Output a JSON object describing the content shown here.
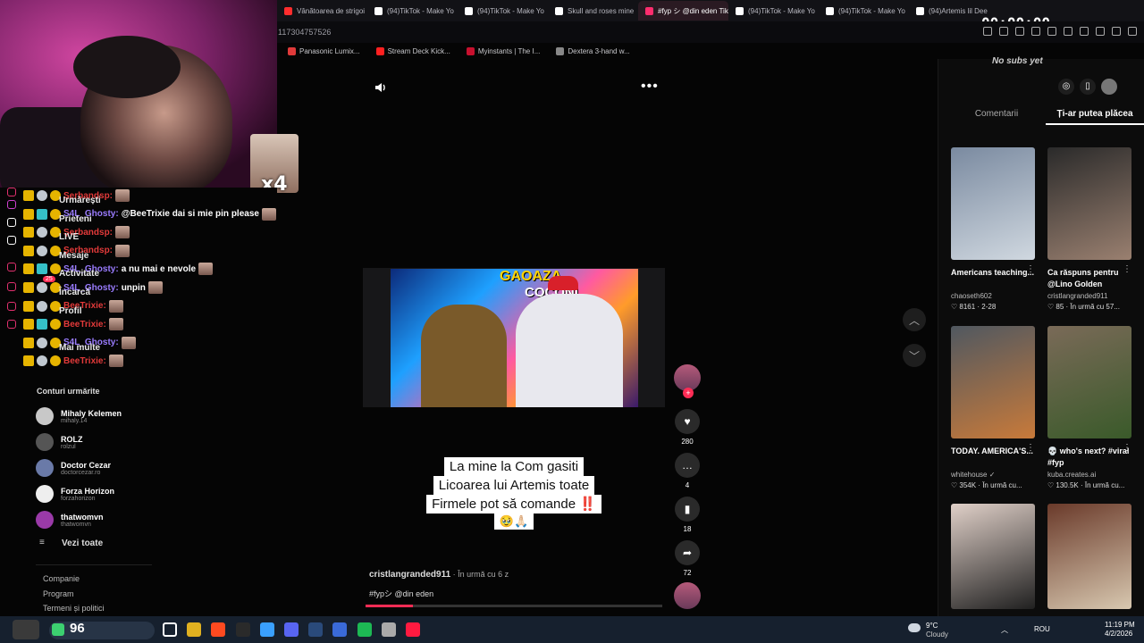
{
  "browser": {
    "tabs": [
      {
        "label": "Vânătoarea de strigoi",
        "color": "#ff2d2d"
      },
      {
        "label": "(94)TikTok - Make Yo",
        "color": "#ffffff"
      },
      {
        "label": "(94)TikTok - Make Yo",
        "color": "#ffffff"
      },
      {
        "label": "Skull and roses mine",
        "color": "#ffffff"
      },
      {
        "label": "#fyp シ @din eden TikTok",
        "color": "#ff2d6e",
        "active": true
      },
      {
        "label": "(94)TikTok - Make Yo",
        "color": "#ffffff"
      },
      {
        "label": "(94)TikTok - Make Yo",
        "color": "#ffffff"
      },
      {
        "label": "(94)Artemis lil Dee",
        "color": "#ffffff"
      }
    ],
    "address_fragment": "117304757526",
    "timer": "00:00:00",
    "bookmarks": [
      {
        "label": "Panasonic Lumix...",
        "color": "#e03a3a"
      },
      {
        "label": "Stream Deck Kick...",
        "color": "#ff2020"
      },
      {
        "label": "Myinstants | The I...",
        "color": "#c8102e"
      },
      {
        "label": "Dextera 3-hand w...",
        "color": "#888888"
      }
    ]
  },
  "webcam": {
    "emote_label": "x4"
  },
  "chat": {
    "rows": [
      {
        "user": "Şerbandsp:",
        "color": "#e33a3a",
        "msg": "",
        "menu": "Urmărești"
      },
      {
        "user": "S4L_Ghosty:",
        "color": "#9a7cff",
        "msg": "@BeeTrixie dai si mie pin please",
        "menu": "Prieteni"
      },
      {
        "user": "Şerbandsp:",
        "color": "#e33a3a",
        "msg": "",
        "menu": "LIVE"
      },
      {
        "user": "Şerbandsp:",
        "color": "#e33a3a",
        "msg": "",
        "menu": "Mesaje"
      },
      {
        "user": "S4L_Ghosty:",
        "color": "#9a7cff",
        "msg": "a nu mai e nevole",
        "menu": "Activitate"
      },
      {
        "user": "S4L_Ghosty:",
        "color": "#9a7cff",
        "msg": "unpin",
        "menu": "Încarcă"
      },
      {
        "user": "BeeTrixie:",
        "color": "#e33a3a",
        "msg": "",
        "menu": "Profil"
      },
      {
        "user": "BeeTrixie:",
        "color": "#e33a3a",
        "msg": "",
        "menu": ""
      },
      {
        "user": "S4L_Ghosty:",
        "color": "#9a7cff",
        "msg": "",
        "menu": "Mai multe"
      },
      {
        "user": "BeeTrixie:",
        "color": "#e33a3a",
        "msg": "",
        "menu": ""
      }
    ],
    "notification_count": "25"
  },
  "following": {
    "title": "Conturi urmărite",
    "accounts": [
      {
        "name": "Mihaly Kelemen",
        "handle": "mihaly.14",
        "color": "#c8c8c8"
      },
      {
        "name": "ROLZ",
        "handle": "rolzul",
        "color": "#555555"
      },
      {
        "name": "Doctor Cezar",
        "handle": "doctorcezar.ro",
        "color": "#6a7aa8"
      },
      {
        "name": "Forza Horizon",
        "handle": "forzahorizon",
        "color": "#eeeeee"
      },
      {
        "name": "thatwomvn",
        "handle": "thatwomvn",
        "color": "#9a3aa8"
      }
    ],
    "see_all": "Vezi toate"
  },
  "footer": [
    "Companie",
    "Program",
    "Termeni și politici"
  ],
  "video": {
    "caption_lines": [
      "La mine la Com gasiti",
      "Licoarea lui Artemis toate",
      "Firmele pot să comande ‼️",
      "🥹🙏🏻"
    ],
    "thumb_title": "GAOAZA",
    "thumb_title2": "COCONI",
    "author": "cristlangranded911",
    "when": " · În urmă cu 6 z",
    "hashtag": "#fypシ @din eden",
    "progress": 0.16,
    "likes": "280",
    "comments": "4",
    "saves": "18",
    "shares": "72"
  },
  "right_panel": {
    "nosubs": "No subs yet",
    "tabs": [
      "Comentarii",
      "Ți-ar putea plăcea"
    ],
    "cards": [
      {
        "title": "Americans teaching...",
        "author": "chaoseth602",
        "stats": "♡ 8161 · 2-28",
        "color1": "#7a8aa0",
        "color2": "#d0d8e0"
      },
      {
        "title": "Ca răspuns pentru @Lino Golden",
        "author": "cristlangranded911",
        "stats": "♡ 85 · În urmă cu 57...",
        "color1": "#2a2a2a",
        "color2": "#9a8070"
      },
      {
        "title": "TODAY. AMERICA'S...",
        "author": "whitehouse ✓",
        "stats": "♡ 354K · În urmă cu...",
        "color1": "#505860",
        "color2": "#c87a3a"
      },
      {
        "title": "💀 who's next? #viral #fyp",
        "author": "kuba.creates.ai",
        "stats": "♡ 130.5K · În urmă cu...",
        "color1": "#7a6a58",
        "color2": "#3a5a2a"
      },
      {
        "title": "",
        "author": "",
        "stats": "",
        "color1": "#e0d0c8",
        "color2": "#202020"
      },
      {
        "title": "",
        "author": "",
        "stats": "",
        "color1": "#6a3a2a",
        "color2": "#d8c8b0"
      }
    ]
  },
  "taskbar": {
    "count": "96",
    "weather_temp": "9°C",
    "weather_desc": "Cloudy",
    "lang": "ROU",
    "time": "11:19 PM",
    "date": "4/2/2026",
    "apps": [
      "#ffffff",
      "#e0b020",
      "#ff4a20",
      "#2a2a2a",
      "#3aa0ff",
      "#5865f2",
      "#2a4a7a",
      "#3a6ad8",
      "#1db954",
      "#aaaaaa",
      "#ff1a40"
    ]
  }
}
